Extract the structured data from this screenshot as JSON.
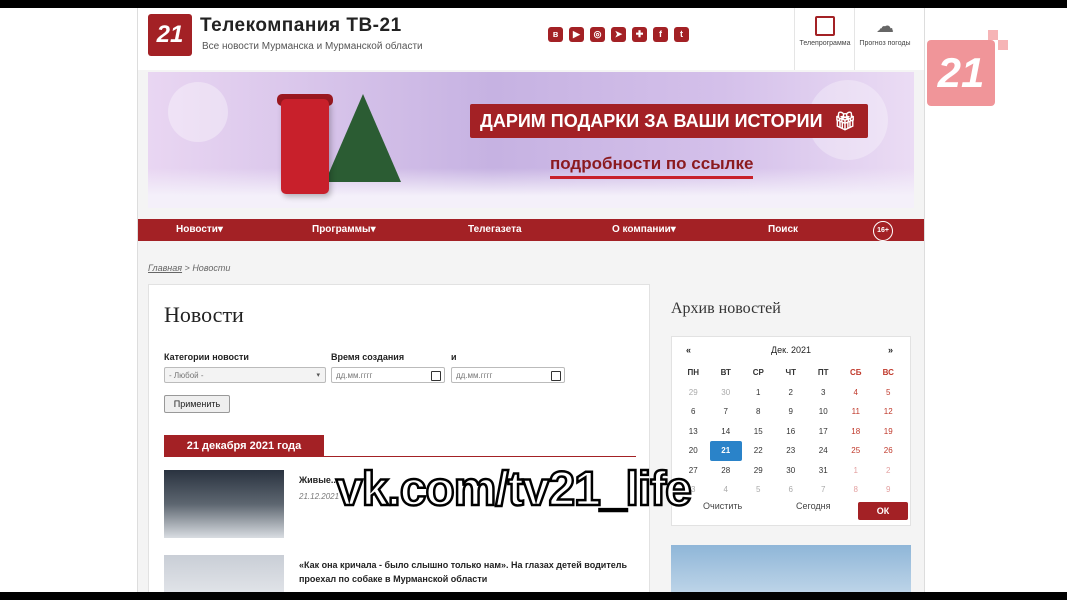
{
  "header": {
    "logo": "21",
    "title": "Телекомпания ТВ-21",
    "subtitle": "Все новости Мурманска и Мурманской области",
    "socials": [
      "vk",
      "youtube",
      "instagram",
      "telegram",
      "ok",
      "facebook",
      "twitter"
    ],
    "tv_program_label": "Телепрограмма",
    "weather_label": "Прогноз погоды"
  },
  "banner": {
    "headline": "ДАРИМ ПОДАРКИ ЗА ВАШИ ИСТОРИИ",
    "link_text": "подробности по ссылке"
  },
  "nav": {
    "items": [
      "Новости▾",
      "Программы▾",
      "Телегазета",
      "О компании▾",
      "Поиск"
    ],
    "age_badge": "16+"
  },
  "breadcrumb": {
    "home": "Главная",
    "separator": " > ",
    "current": "Новости"
  },
  "main": {
    "title": "Новости",
    "filters": {
      "category_label": "Категории новости",
      "category_value": "- Любой -",
      "time_label": "Время создания",
      "time_placeholder": "дд.мм.гггг",
      "and_label": "и",
      "and_placeholder": "дд.мм.гггг",
      "apply_label": "Применить"
    },
    "date_header": "21 декабря 2021 года",
    "news": [
      {
        "title": "Живые...",
        "date": "21.12.2021"
      },
      {
        "title": "«Как она кричала - было слышно только нам». На глазах детей водитель проехал по собаке в Мурманской области",
        "date": ""
      }
    ]
  },
  "sidebar": {
    "archive_title": "Архив новостей",
    "calendar": {
      "prev": "«",
      "next": "»",
      "month": "Дек. 2021",
      "weekdays": [
        "ПН",
        "ВТ",
        "СР",
        "ЧТ",
        "ПТ",
        "СБ",
        "ВС"
      ],
      "weeks": [
        [
          "29",
          "30",
          "1",
          "2",
          "3",
          "4",
          "5"
        ],
        [
          "6",
          "7",
          "8",
          "9",
          "10",
          "11",
          "12"
        ],
        [
          "13",
          "14",
          "15",
          "16",
          "17",
          "18",
          "19"
        ],
        [
          "20",
          "21",
          "22",
          "23",
          "24",
          "25",
          "26"
        ],
        [
          "27",
          "28",
          "29",
          "30",
          "31",
          "1",
          "2"
        ],
        [
          "3",
          "4",
          "5",
          "6",
          "7",
          "8",
          "9"
        ]
      ],
      "selected": "21",
      "clear_label": "Очистить",
      "today_label": "Сегодня",
      "ok_label": "ОК"
    }
  },
  "overlay": {
    "channel_logo": "21",
    "watermark": "vk.com/tv21_life"
  },
  "colors": {
    "brand_red": "#a32125",
    "selected_blue": "#2a83c9"
  }
}
